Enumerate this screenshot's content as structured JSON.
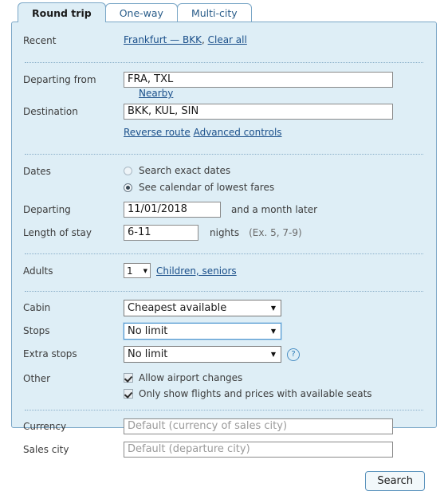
{
  "tabs": [
    {
      "label": "Round trip",
      "active": true
    },
    {
      "label": "One-way",
      "active": false
    },
    {
      "label": "Multi-city",
      "active": false
    }
  ],
  "recent": {
    "label": "Recent",
    "item": "Frankfurt — BKK",
    "comma": ",",
    "clear_all": "Clear all"
  },
  "route": {
    "departing_from_label": "Departing from",
    "departing_from_value": "FRA, TXL",
    "destination_label": "Destination",
    "destination_value": "BKK, KUL, SIN",
    "nearby_link": "Nearby",
    "reverse_route_link": "Reverse route",
    "advanced_controls_link": "Advanced controls"
  },
  "dates": {
    "label": "Dates",
    "option_exact": "Search exact dates",
    "option_calendar": "See calendar of lowest fares",
    "selected_option": "calendar",
    "departing_label": "Departing",
    "departing_value": "11/01/2018",
    "departing_suffix": "and a month later",
    "length_label": "Length of stay",
    "length_value": "6-11",
    "nights_label": "nights",
    "length_hint": "(Ex. 5, 7-9)"
  },
  "passengers": {
    "adults_label": "Adults",
    "adults_value": "1",
    "children_seniors_link": "Children, seniors"
  },
  "options": {
    "cabin_label": "Cabin",
    "cabin_value": "Cheapest available",
    "stops_label": "Stops",
    "stops_value": "No limit",
    "extra_stops_label": "Extra stops",
    "extra_stops_value": "No limit",
    "help_icon": "?",
    "other_label": "Other",
    "allow_airport_changes": "Allow airport changes",
    "allow_airport_changes_checked": true,
    "available_seats_only": "Only show flights and prices with available seats",
    "available_seats_only_checked": true
  },
  "locale": {
    "currency_label": "Currency",
    "currency_placeholder": "Default (currency of sales city)",
    "currency_value": "",
    "sales_city_label": "Sales city",
    "sales_city_placeholder": "Default (departure city)",
    "sales_city_value": ""
  },
  "actions": {
    "search_button": "Search"
  },
  "colors": {
    "panel_bg": "#deeef6",
    "panel_border": "#7ba7c7",
    "link": "#1a4f8a",
    "focus_ring": "#4b95cf"
  }
}
